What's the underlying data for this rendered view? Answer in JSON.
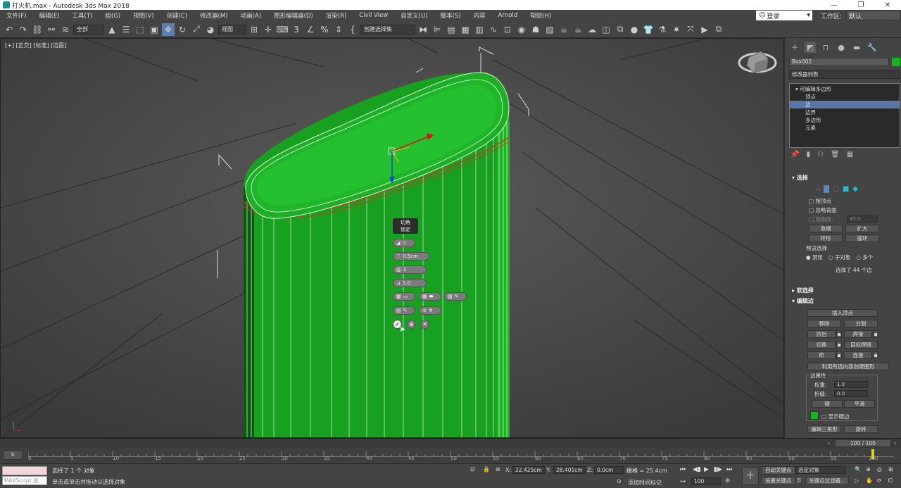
{
  "window": {
    "title": "打火机.max - Autodesk 3ds Max 2018",
    "controls": [
      "—",
      "❐",
      "✕"
    ]
  },
  "menu": [
    "文件(F)",
    "编辑(E)",
    "工具(T)",
    "组(G)",
    "视图(V)",
    "创建(C)",
    "修改器(M)",
    "动画(A)",
    "图形编辑器(D)",
    "渲染(R)",
    "Civil View",
    "自定义(U)",
    "脚本(S)",
    "内容",
    "Arnold",
    "帮助(H)"
  ],
  "account": {
    "login_label": "登录",
    "workspace_label": "工作区:",
    "workspace_value": "默认"
  },
  "toolbar": {
    "selection_filter": "全部",
    "ref_coord": "视图",
    "named_selection": "创建选择集"
  },
  "viewport": {
    "label": "[+] [正交] [标准] [边面]",
    "caddy": {
      "title_line1": "切角",
      "title_line2": "锁定",
      "amount": "0.5cm",
      "segments": "1",
      "tension": "1.0"
    }
  },
  "command_panel": {
    "object_name": "Box002",
    "object_color": "#13b820",
    "modifier_list": "修改器列表",
    "stack": {
      "root": "可编辑多边形",
      "items": [
        "顶点",
        "边",
        "边界",
        "多边形",
        "元素"
      ],
      "selected_index": 1
    },
    "selection": {
      "header": "选择",
      "by_vertex": "按顶点",
      "ignore_backfacing": "忽略背面",
      "by_angle": "按角度:",
      "angle_value": "45.0",
      "shrink": "收缩",
      "grow": "扩大",
      "ring": "环形",
      "loop": "循环",
      "preview_label": "预览选择",
      "preview_options": [
        "禁用",
        "子对象",
        "多个"
      ],
      "status": "选择了 44 个边"
    },
    "soft_selection": {
      "header": "软选择"
    },
    "edit_edges": {
      "header": "编辑边",
      "insert_vertex": "插入顶点",
      "remove": "移除",
      "split": "分割",
      "extrude": "挤出",
      "weld": "焊接",
      "chamfer": "切角",
      "target_weld": "目标焊接",
      "bridge": "桥",
      "connect": "连接",
      "create_shape": "利用所选内容创建图形",
      "edge_props": "边属性",
      "weight_label": "权重:",
      "weight_value": "1.0",
      "crease_label": "折缝:",
      "crease_value": "0.0",
      "hard": "硬",
      "smooth": "平滑",
      "show_hard": "显示硬边",
      "edit_tri": "编辑三角形",
      "turn": "旋转"
    }
  },
  "timeline": {
    "frame_display": "100 / 100",
    "ticks": [
      "0",
      "5",
      "10",
      "15",
      "20",
      "25",
      "30",
      "35",
      "40",
      "45",
      "50",
      "55",
      "60",
      "65",
      "70",
      "75",
      "80",
      "85",
      "90",
      "95",
      "100"
    ]
  },
  "statusbar": {
    "maxscript_placeholder": "MAXScript 迷",
    "line1": "选择了 1 个 对象",
    "line2": "单击或单击并拖动以选择对象",
    "x_label": "X:",
    "x_value": "22.425cm",
    "y_label": "Y:",
    "y_value": "28.401cm",
    "z_label": "Z:",
    "z_value": "0.0cm",
    "grid": "栅格 = 25.4cm",
    "add_time_tag": "添加时间标记",
    "frame": "100",
    "auto_key": "自动关键点",
    "selected_obj": "选定对象",
    "set_key": "设置关键点",
    "key_filters": "关键点过滤器..."
  }
}
